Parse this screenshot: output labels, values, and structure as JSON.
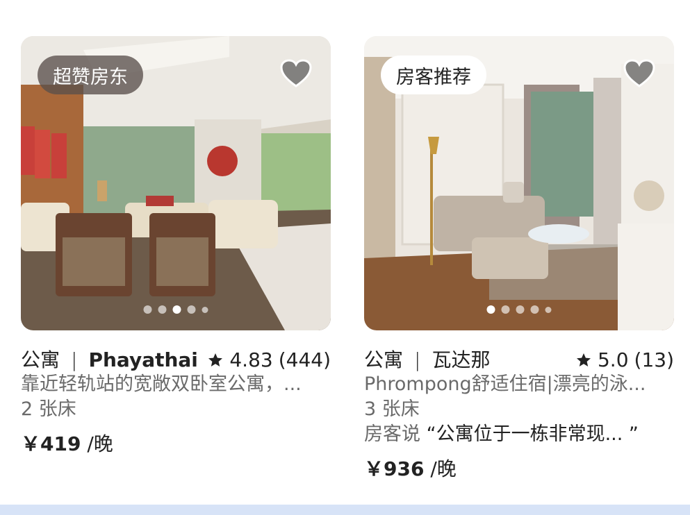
{
  "listings": [
    {
      "badge": "超赞房东",
      "type": "公寓",
      "separator": "|",
      "location": "Phayathai",
      "rating": "4.83",
      "reviews": "(444)",
      "description": "靠近轻轨站的宽敞双卧室公寓，...",
      "beds": "2 张床",
      "price": "￥419",
      "price_unit": " /晚",
      "photo_dots": 5,
      "active_dot": 2
    },
    {
      "badge": "房客推荐",
      "type": "公寓",
      "separator": "|",
      "location": "瓦达那",
      "rating": "5.0",
      "reviews": "(13)",
      "description": "Phrompong舒适住宿|漂亮的泳...",
      "beds": "3 张床",
      "review_prefix": "房客说",
      "review_quote": "“公寓位于一栋非常现... ”",
      "price": "￥936",
      "price_unit": " /晚",
      "photo_dots": 5,
      "active_dot": 0
    }
  ],
  "colors": {
    "text": "#222222",
    "muted": "#6a6a6a",
    "footer": "#d7e3f7"
  },
  "icons": [
    "heart-icon",
    "star-icon"
  ]
}
